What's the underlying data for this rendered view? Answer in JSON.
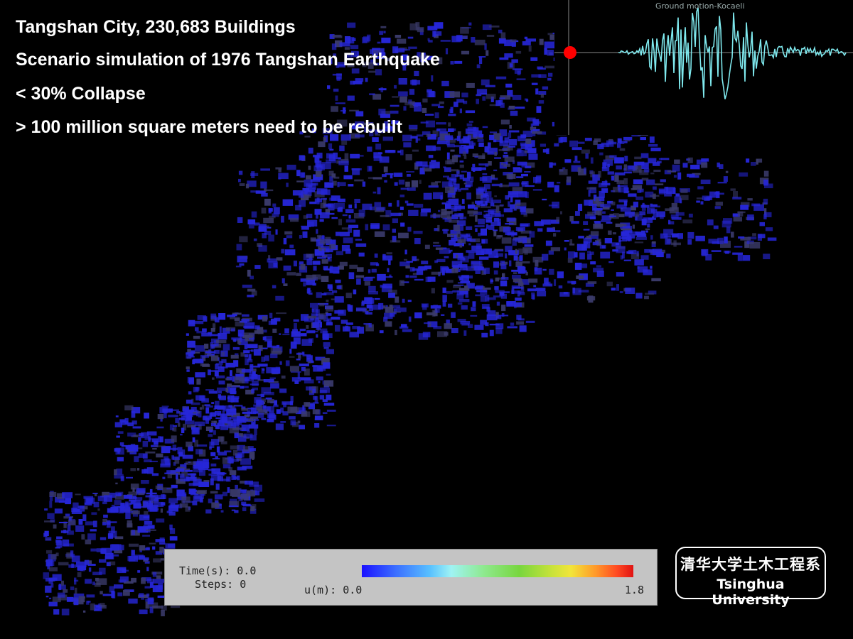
{
  "headline": {
    "line1": "Tangshan City, 230,683 Buildings",
    "line2": "Scenario simulation of 1976 Tangshan Earthquake",
    "line3": "< 30% Collapse",
    "line4": "> 100 million square meters need to be rebuilt"
  },
  "ground_motion": {
    "title": "Ground motion-Kocaeli",
    "marker_color": "#ff0000",
    "trace_color": "#7fe9ee"
  },
  "legend": {
    "time_label": "Time(s):",
    "time_value": "0.0",
    "steps_label": "Steps:",
    "steps_value": "0",
    "u_label": "u(m):",
    "u_min": "0.0",
    "u_max": "1.8"
  },
  "logo": {
    "cn": "清华大学土木工程系",
    "en": "Tsinghua University"
  },
  "map": {
    "building_color": "#2626d8",
    "building_color_dim": "#3a3a6a"
  }
}
